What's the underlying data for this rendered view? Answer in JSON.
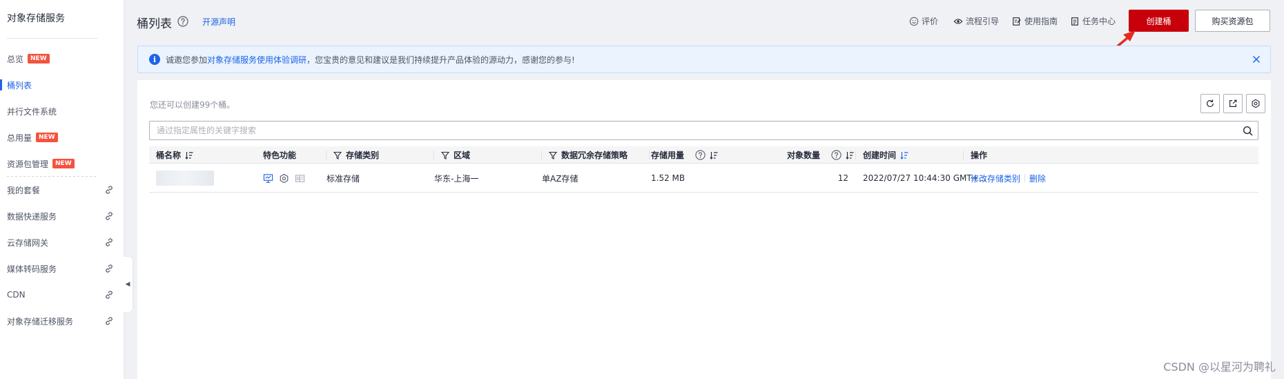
{
  "sidebar": {
    "title": "对象存储服务",
    "items": [
      {
        "label": "总览",
        "badge": "NEW"
      },
      {
        "label": "桶列表"
      },
      {
        "label": "并行文件系统"
      },
      {
        "label": "总用量",
        "badge": "NEW"
      },
      {
        "label": "资源包管理",
        "badge": "NEW"
      },
      {
        "label": "我的套餐"
      },
      {
        "label": "数据快递服务"
      },
      {
        "label": "云存储网关"
      },
      {
        "label": "媒体转码服务"
      },
      {
        "label": "CDN"
      },
      {
        "label": "对象存储迁移服务"
      }
    ]
  },
  "header": {
    "title": "桶列表",
    "open_source": "开源声明",
    "links": [
      "评价",
      "流程引导",
      "使用指南",
      "任务中心"
    ],
    "create_button": "创建桶",
    "buy_button": "购买资源包"
  },
  "notice": {
    "prefix": "诚邀您参加",
    "link": "对象存储服务使用体验调研",
    "suffix": "，您宝贵的意见和建议是我们持续提升产品体验的源动力，感谢您的参与!"
  },
  "main": {
    "quota": "您还可以创建99个桶。",
    "search_placeholder": "通过指定属性的关键字搜索"
  },
  "table": {
    "columns": [
      "桶名称",
      "特色功能",
      "存储类别",
      "区域",
      "数据冗余存储策略",
      "存储用量",
      "对象数量",
      "创建时间",
      "操作"
    ],
    "rows": [
      {
        "storage_class": "标准存储",
        "region": "华东-上海一",
        "redundancy": "单AZ存储",
        "usage": "1.52 MB",
        "objects": "12",
        "created": "2022/07/27 10:44:30 GMT+...",
        "op_modify": "修改存储类别",
        "op_delete": "删除"
      }
    ]
  },
  "watermark": "CSDN @以星河为聘礼",
  "colors": {
    "primary": "#c7000b",
    "link": "#1e64e6",
    "badge": "#f3533f",
    "notice_bg": "#eaf3fe"
  }
}
